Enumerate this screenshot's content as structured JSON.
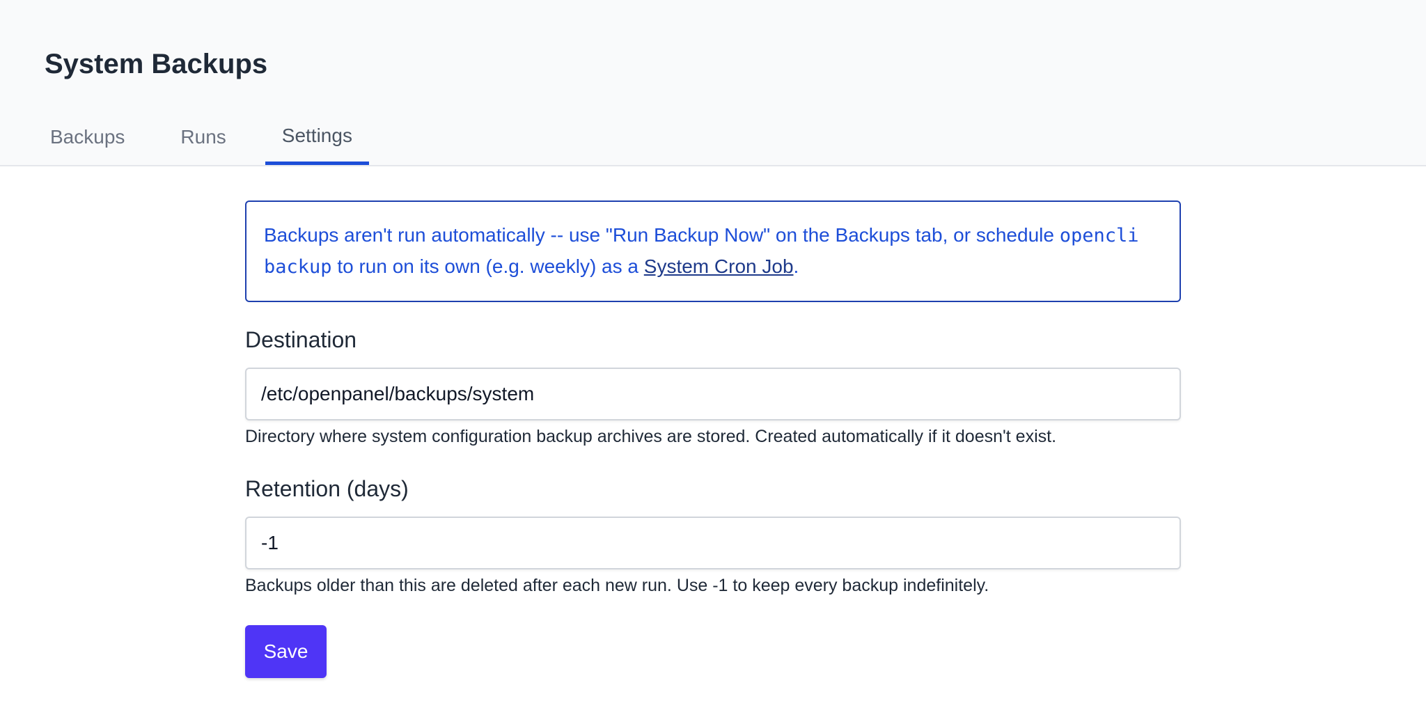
{
  "header": {
    "title": "System Backups",
    "tabs": [
      {
        "label": "Backups",
        "active": false
      },
      {
        "label": "Runs",
        "active": false
      },
      {
        "label": "Settings",
        "active": true
      }
    ]
  },
  "info": {
    "text_before": "Backups aren't run automatically -- use \"Run Backup Now\" on the Backups tab, or schedule ",
    "code": "opencli backup",
    "text_middle": " to run on its own (e.g. weekly) as a ",
    "link": "System Cron Job",
    "text_after": "."
  },
  "destination": {
    "label": "Destination",
    "value": "/etc/openpanel/backups/system",
    "help": "Directory where system configuration backup archives are stored. Created automatically if it doesn't exist."
  },
  "retention": {
    "label": "Retention (days)",
    "value": "-1",
    "help": "Backups older than this are deleted after each new run. Use -1 to keep every backup indefinitely."
  },
  "save_label": "Save",
  "colors": {
    "accent": "#4f35f6",
    "tab_underline": "#1d4ed8",
    "info_text": "#1d4ed8",
    "info_border": "#1e40af"
  }
}
